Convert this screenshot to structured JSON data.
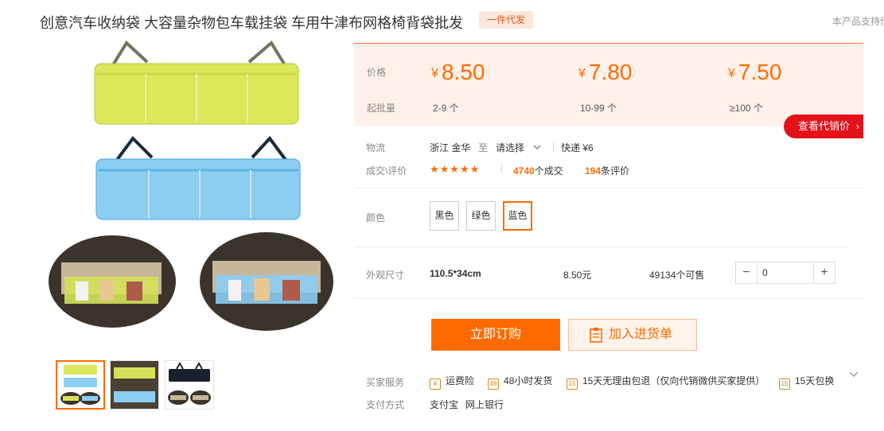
{
  "product": {
    "title": "创意汽车收纳袋 大容量杂物包车载挂袋 车用牛津布网格椅背袋批发",
    "tag": "一件代发",
    "support_text": "本产品支持传"
  },
  "price_tiers": {
    "price_label": "价格",
    "batch_label": "起批量",
    "currency": "¥",
    "tiers": [
      {
        "price": "8.50",
        "range": "2-9 个"
      },
      {
        "price": "7.80",
        "range": "10-99 个"
      },
      {
        "price": "7.50",
        "range": "≥100 个"
      }
    ],
    "agent_price_button": "查看代销价",
    "agent_price_arrow": "›"
  },
  "logistics": {
    "label": "物流",
    "origin": "浙江 金华",
    "to": "至",
    "destination": "请选择",
    "dropdown_icon": "chevron-down-icon",
    "express": "快递 ¥6"
  },
  "deals": {
    "label": "成交\\评价",
    "rating_stars": 5,
    "stars_text": "★★★★★",
    "deal_count": "4740",
    "deal_suffix": "个成交",
    "review_count": "194",
    "review_suffix": "条评价"
  },
  "color": {
    "label": "颜色",
    "options": [
      "黑色",
      "绿色",
      "蓝色"
    ],
    "selected": "蓝色"
  },
  "sku": {
    "label": "外观尺寸",
    "size": "110.5*34cm",
    "price": "8.50元",
    "stock": "49134个可售",
    "quantity_minus": "−",
    "quantity_value": "0",
    "quantity_plus": "+"
  },
  "actions": {
    "buy_now": "立即订购",
    "add_to_list": "加入进货单"
  },
  "services": {
    "label": "买家服务",
    "items": [
      {
        "icon": "shipping-insurance-icon",
        "text": "运费险"
      },
      {
        "icon": "48h-delivery-icon",
        "text": "48小时发货"
      },
      {
        "icon": "15day-return-icon",
        "text": "15天无理由包退（仅向代销微供买家提供）"
      },
      {
        "icon": "15day-exchange-icon",
        "text": "15天包换"
      }
    ],
    "icon_glyphs": [
      "¥",
      "48",
      "15",
      "15"
    ]
  },
  "payment": {
    "label": "支付方式",
    "methods": [
      "支付宝",
      "网上银行"
    ]
  },
  "colors": {
    "accent": "#ff6a00",
    "price_bg": "#fff1e9",
    "agent_btn": "#e3111a",
    "bag_green": "#dbe85a",
    "bag_blue": "#8ccdf2"
  }
}
